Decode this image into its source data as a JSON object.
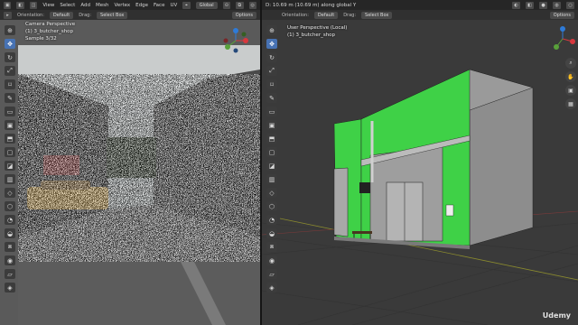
{
  "left_header": {
    "menu": [
      "View",
      "Select",
      "Add",
      "Mesh",
      "Vertex",
      "Edge",
      "Face",
      "UV"
    ],
    "transform": "Global",
    "orientation_label": "Orientation:",
    "orientation_value": "Default",
    "drag_label": "Drag:",
    "drag_value": "Select Box",
    "options": "Options"
  },
  "left_viewport": {
    "overlay_line1": "Camera Perspective",
    "overlay_line2": "(1) 3_butcher_shop",
    "overlay_line3": "Sample 3/32"
  },
  "right_header": {
    "status": "D: 10.69 m (10.69 m) along global Y",
    "orientation_label": "Orientation:",
    "orientation_value": "Default",
    "drag_label": "Drag:",
    "drag_value": "Select Box",
    "options": "Options"
  },
  "right_viewport": {
    "overlay_line1": "User Perspective (Local)",
    "overlay_line2": "(1) 3_butcher_shop"
  },
  "watermark": "Udemy",
  "colors": {
    "active_tool": "#4772b3",
    "wall_green": "#3fd147",
    "grid_bg": "#3a3a3a"
  },
  "icons": [
    "cursor-icon",
    "move-icon",
    "rotate-icon",
    "scale-icon",
    "transform-icon",
    "annotate-icon",
    "measure-icon",
    "add-cube-icon",
    "extrude-icon",
    "inset-icon",
    "bevel-icon",
    "loopcut-icon",
    "knife-icon",
    "polybuild-icon",
    "spin-icon",
    "smooth-icon",
    "edge-slide-icon",
    "shrink-icon",
    "shear-icon",
    "rip-icon"
  ]
}
